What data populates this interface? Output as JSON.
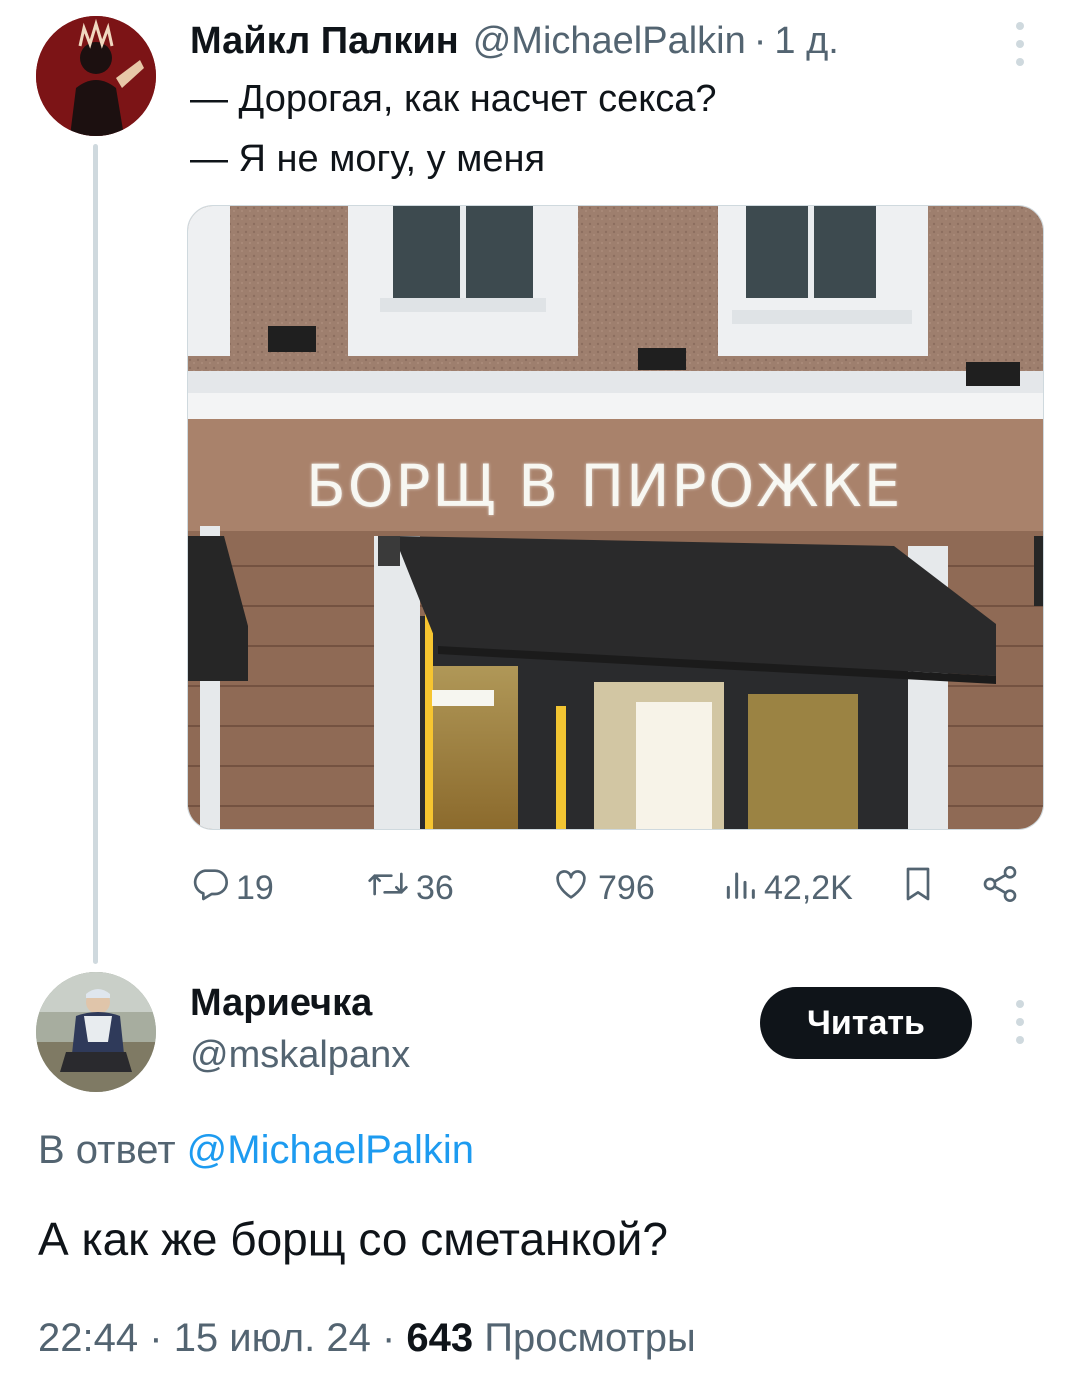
{
  "tweet": {
    "author_name": "Майкл Палкин",
    "author_handle": "@MichaelPalkin",
    "separator": "·",
    "time": "1 д.",
    "lines": [
      "— Дорогая, как насчет секса?",
      "— Я не могу, у меня"
    ],
    "image": {
      "sign_text": "БОРЩ В ПИРОЖКЕ"
    },
    "stats": {
      "replies": "19",
      "retweets": "36",
      "likes": "796",
      "views": "42,2K"
    }
  },
  "reply": {
    "author_name": "Мариечка",
    "author_handle": "@mskalpanx",
    "follow_label": "Читать",
    "in_reply_prefix": "В ответ",
    "in_reply_mention": "@MichaelPalkin",
    "text": "А как же борщ со сметанкой?",
    "time": "22:44",
    "date": "15 июл. 24",
    "separator": "·",
    "views_count": "643",
    "views_label": "Просмотры"
  },
  "colors": {
    "text": "#0f1419",
    "secondary": "#536471",
    "link": "#1d9bf0",
    "button": "#0f1419",
    "thread_line": "#cfd9de"
  },
  "icons": [
    "reply-icon",
    "retweet-icon",
    "like-icon",
    "views-icon",
    "bookmark-icon",
    "share-icon",
    "more-icon"
  ]
}
